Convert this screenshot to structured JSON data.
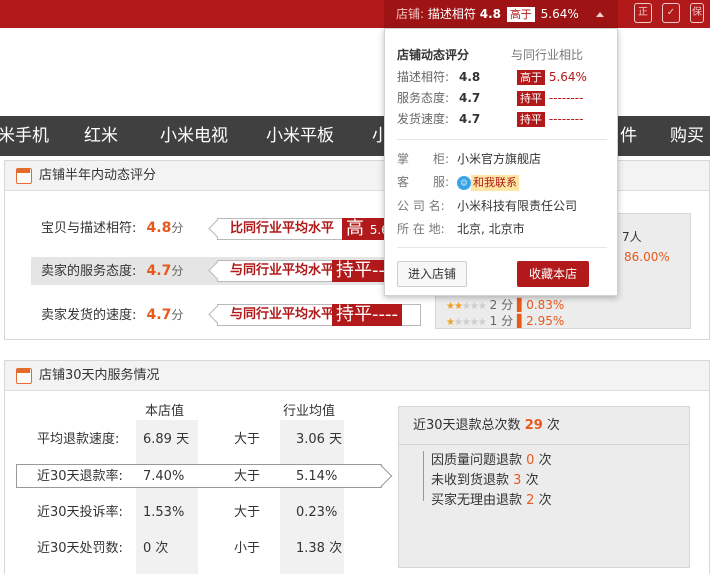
{
  "top_summary": {
    "label": "店铺:",
    "metric": "描述相符",
    "score": "4.8",
    "compare": "高于",
    "percent": "5.64%"
  },
  "nav": [
    "米手机",
    "红米",
    "小米电视",
    "小米平板",
    "小",
    "件",
    "购买须"
  ],
  "popup": {
    "title": "店铺动态评分",
    "compare_title": "与同行业相比",
    "rows": [
      {
        "label": "描述相符:",
        "score": "4.8",
        "tag": "高于",
        "value": "5.64%"
      },
      {
        "label": "服务态度:",
        "score": "4.7",
        "tag": "持平",
        "value": "--------"
      },
      {
        "label": "发货速度:",
        "score": "4.7",
        "tag": "持平",
        "value": "--------"
      }
    ],
    "info": [
      {
        "label": "掌　　柜:",
        "value": "小米官方旗舰店"
      },
      {
        "label": "客　　服:",
        "value": "和我联系"
      },
      {
        "label": "公 司 名:",
        "value": "小米科技有限责任公司"
      },
      {
        "label": "所 在 地:",
        "value": "北京, 北京市"
      }
    ],
    "enter_label": "进入店铺",
    "fav_label": "收藏本店"
  },
  "panel1": {
    "title": "店铺半年内动态评分",
    "rows": [
      {
        "label": "宝贝与描述相符:",
        "score": "4.8",
        "unit": "分",
        "ribbon": "比同行业平均水平",
        "big": "高",
        "pct": "5.6"
      },
      {
        "label": "卖家的服务态度:",
        "score": "4.7",
        "unit": "分",
        "ribbon": "与同行业平均水平",
        "big": "持平",
        "pct": "--"
      },
      {
        "label": "卖家发货的速度:",
        "score": "4.7",
        "unit": "分",
        "ribbon": "与同行业平均水平",
        "big": "持平",
        "pct": "----"
      }
    ],
    "dist": {
      "count_suffix": "7人",
      "top_pct": "86.00%",
      "rows": [
        {
          "score": "2 分",
          "pct": "0.83%"
        },
        {
          "score": "1 分",
          "pct": "2.95%"
        }
      ]
    }
  },
  "panel2": {
    "title": "店铺30天内服务情况",
    "col_store": "本店值",
    "col_industry": "行业均值",
    "rows": [
      {
        "label": "平均退款速度:",
        "store": "6.89 天",
        "cmp": "大于",
        "industry": "3.06 天"
      },
      {
        "label": "近30天退款率:",
        "store": "7.40%",
        "cmp": "大于",
        "industry": "5.14%"
      },
      {
        "label": "近30天投诉率:",
        "store": "1.53%",
        "cmp": "大于",
        "industry": "0.23%"
      },
      {
        "label": "近30天处罚数:",
        "store": "0 次",
        "cmp": "小于",
        "industry": "1.38 次"
      }
    ],
    "refund": {
      "title": "近30天退款总次数",
      "total": "29",
      "unit": "次",
      "items": [
        {
          "label": "因质量问题退款",
          "count": "0",
          "unit": "次"
        },
        {
          "label": "未收到货退款",
          "count": "3",
          "unit": "次"
        },
        {
          "label": "买家无理由退款",
          "count": "2",
          "unit": "次"
        }
      ]
    }
  }
}
